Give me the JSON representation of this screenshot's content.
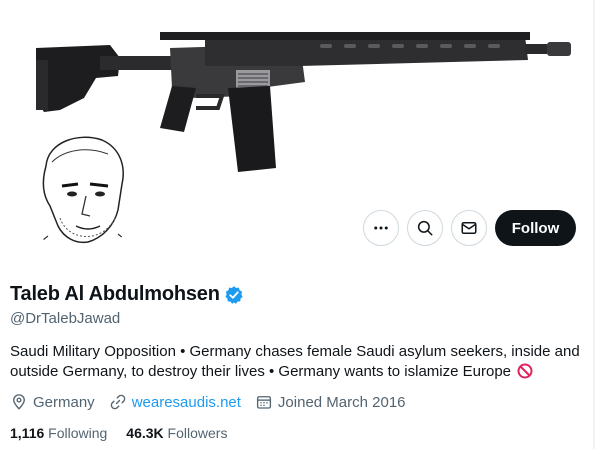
{
  "profile": {
    "display_name": "Taleb Al Abdulmohsen",
    "handle": "@DrTalebJawad",
    "bio": "Saudi Military Opposition • Germany chases female Saudi asylum seekers, inside and outside Germany, to destroy their lives • Germany wants to islamize Europe",
    "bio_emoji": "no-entry-sign-icon",
    "location": "Germany",
    "website": "wearesaudis.net",
    "joined": "Joined March 2016",
    "following_count": "1,116",
    "following_label": "Following",
    "followers_count": "46.3K",
    "followers_label": "Followers"
  },
  "actions": {
    "more": "more-icon",
    "search": "search-icon",
    "message": "envelope-icon",
    "follow_label": "Follow"
  },
  "colors": {
    "accent": "#1d9bf0",
    "text": "#0f1419",
    "secondary": "#536471",
    "follow_bg": "#0f1419"
  }
}
